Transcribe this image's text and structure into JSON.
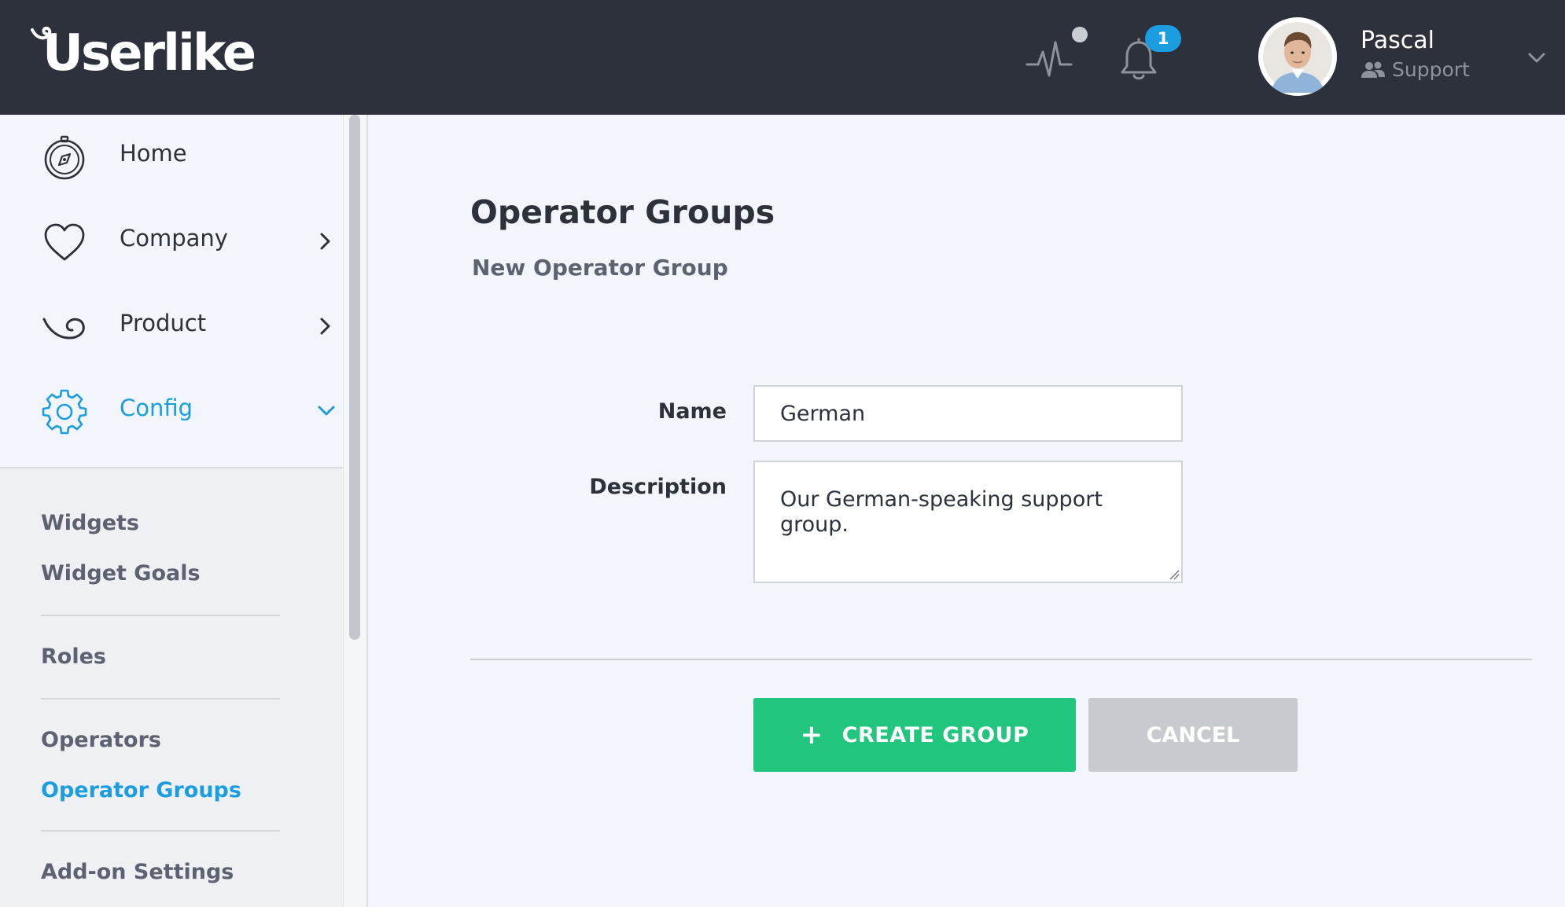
{
  "header": {
    "logo_text": "Userlike",
    "notifications_count": "1",
    "user": {
      "name": "Pascal",
      "role": "Support"
    }
  },
  "sidebar": {
    "nav": [
      {
        "label": "Home",
        "icon": "compass-icon"
      },
      {
        "label": "Company",
        "icon": "heart-icon"
      },
      {
        "label": "Product",
        "icon": "product-swirl-icon"
      },
      {
        "label": "Config",
        "icon": "gear-icon",
        "active": true
      }
    ],
    "sub_items": {
      "widgets": "Widgets",
      "widget_goals": "Widget Goals",
      "roles": "Roles",
      "operators": "Operators",
      "operator_groups": "Operator Groups",
      "addon_settings": "Add-on Settings"
    }
  },
  "main": {
    "title": "Operator Groups",
    "subtitle": "New Operator Group",
    "form": {
      "name_label": "Name",
      "name_value": "German",
      "description_label": "Description",
      "description_value": "Our German-speaking support group."
    },
    "buttons": {
      "create": "CREATE GROUP",
      "cancel": "CANCEL"
    }
  },
  "colors": {
    "topbar": "#2c313c",
    "accent": "#1b9de0",
    "create_button": "#22c57e",
    "cancel_button": "#c7cace"
  }
}
